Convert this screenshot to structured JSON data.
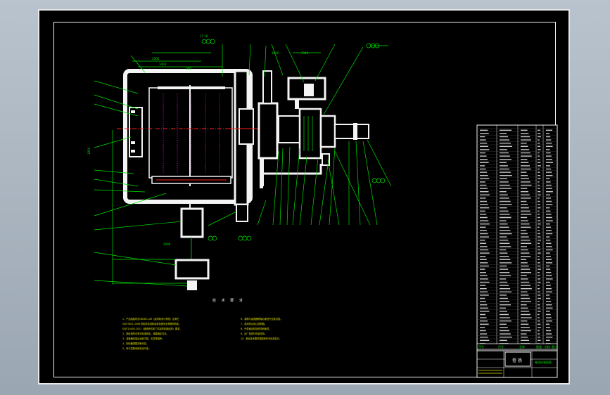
{
  "title": "技 术 要 求",
  "colors": {
    "background": "#b9c3cd",
    "sheet": "#000000",
    "outline": "#f4f4f4",
    "leader": "#00e000",
    "hatch": "#e000e0",
    "centerline": "#ff2020",
    "notes": "#e0e000"
  },
  "tech_notes_left": [
    "1、产品组装符合GB3811-83（起重机设计规范）及其它",
    "GB/T3811-2008 的相关标准和起重机械安全规程的规定。",
    "GB/T14405-2011（通用桥式和门式起重机钢结构）要求。",
    "2、钢丝绳符合有关标准规定，绳端固定可靠。",
    "3、减速器安装后运转平稳，无异常噪声。",
    "4、制动器调整灵敏可靠。",
    "5、电气控制系统安全可靠。"
  ],
  "tech_notes_right": [
    "6、卷筒与减速器联接后需进行空载试验。",
    "7、各润滑点加注润滑脂。",
    "8、外表面涂防锈底漆和面漆。",
    "9、出厂前进行负载试验。",
    "10、其余技术要求按国家有关标准执行。"
  ],
  "callouts_top": [
    "2",
    "3",
    "4",
    "5",
    "6",
    "7",
    "8",
    "9",
    "10",
    "11",
    "12",
    "13"
  ],
  "title_block": {
    "header_cells": [
      "序号",
      "代号",
      "名称",
      "数量",
      "材料",
      "备注"
    ],
    "drawing_name": "卷 扬",
    "label_small": "卷扬机装配图"
  }
}
